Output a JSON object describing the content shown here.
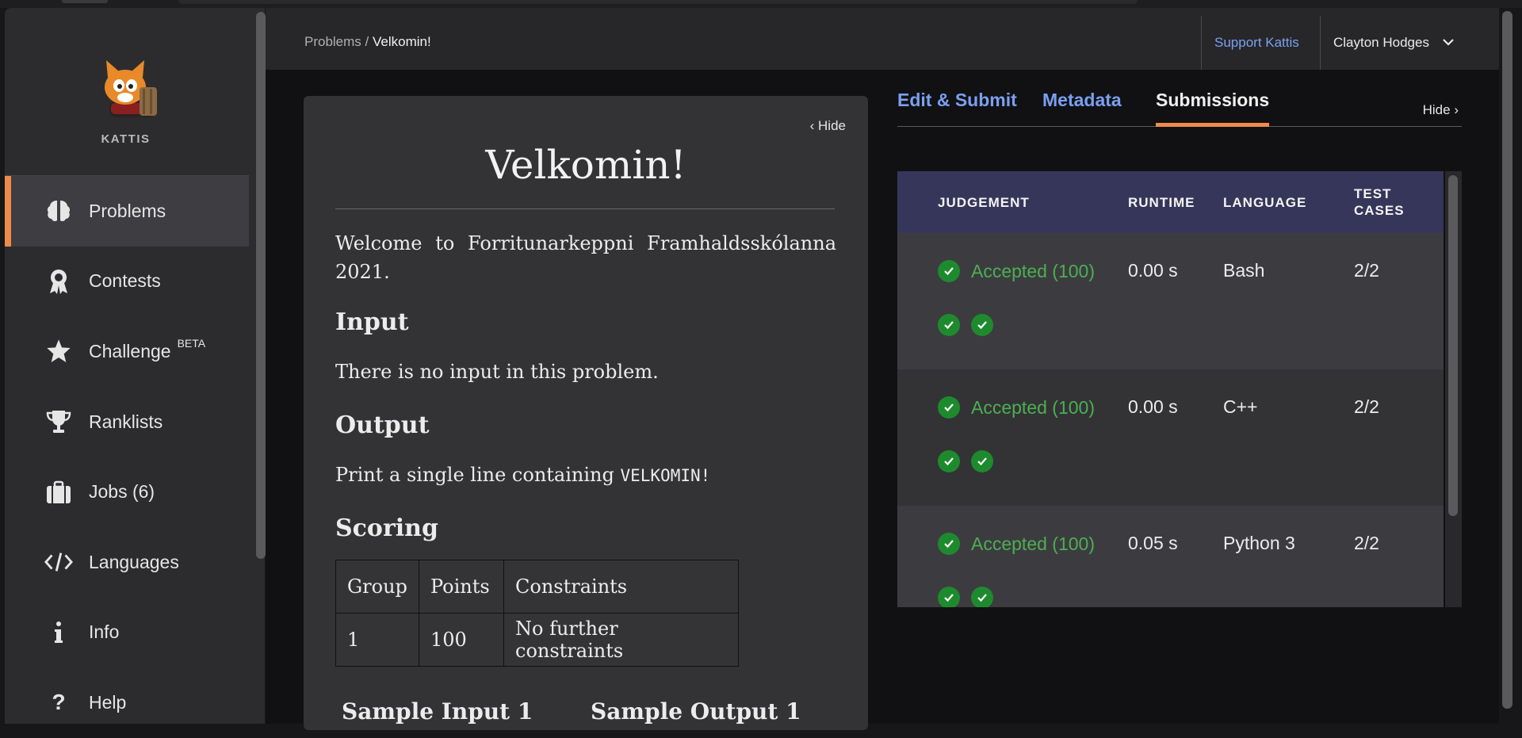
{
  "sidebar": {
    "logo_text": "KATTIS",
    "items": [
      {
        "label": "Problems",
        "icon": "brain-icon",
        "sup": ""
      },
      {
        "label": "Contests",
        "icon": "award-icon",
        "sup": ""
      },
      {
        "label": "Challenge",
        "icon": "star-icon",
        "sup": "BETA"
      },
      {
        "label": "Ranklists",
        "icon": "trophy-icon",
        "sup": ""
      },
      {
        "label": "Jobs (6)",
        "icon": "briefcase-icon",
        "sup": ""
      },
      {
        "label": "Languages",
        "icon": "code-icon",
        "sup": ""
      },
      {
        "label": "Info",
        "icon": "info-icon",
        "sup": ""
      },
      {
        "label": "Help",
        "icon": "question-icon",
        "sup": ""
      }
    ]
  },
  "header": {
    "crumb_root": "Problems",
    "crumb_sep": " / ",
    "crumb_current": "Velkomin!",
    "support": "Support Kattis",
    "user": "Clayton Hodges"
  },
  "problem": {
    "hide": "Hide",
    "title": "Velkomin!",
    "intro": "Welcome to Forritunarkeppni Framhaldsskólanna 2021.",
    "input_heading": "Input",
    "input_text": "There is no input in this problem.",
    "output_heading": "Output",
    "output_text": "Print a single line containing ",
    "output_code": "VELKOMIN!",
    "scoring_heading": "Scoring",
    "scoring_table": {
      "headers": [
        "Group",
        "Points",
        "Constraints"
      ],
      "rows": [
        [
          "1",
          "100",
          "No further constraints"
        ]
      ]
    },
    "sample_input": "Sample Input 1",
    "sample_output": "Sample Output 1"
  },
  "tabs": {
    "items": [
      "Edit & Submit",
      "Metadata",
      "Submissions"
    ],
    "active": "Submissions",
    "hide": "Hide"
  },
  "submissions": {
    "headers": {
      "judgement": "JUDGEMENT",
      "runtime": "RUNTIME",
      "language": "LANGUAGE",
      "test_cases_1": "TEST",
      "test_cases_2": "CASES"
    },
    "rows": [
      {
        "judgement": "Accepted (100)",
        "runtime": "0.00 s",
        "language": "Bash",
        "tests": "2/2"
      },
      {
        "judgement": "Accepted (100)",
        "runtime": "0.00 s",
        "language": "C++",
        "tests": "2/2"
      },
      {
        "judgement": "Accepted (100)",
        "runtime": "0.05 s",
        "language": "Python 3",
        "tests": "2/2"
      }
    ]
  },
  "colors": {
    "accent": "#f08a4b",
    "link": "#7aa0f0",
    "accepted": "#4caf50",
    "table_header": "#36365a"
  }
}
